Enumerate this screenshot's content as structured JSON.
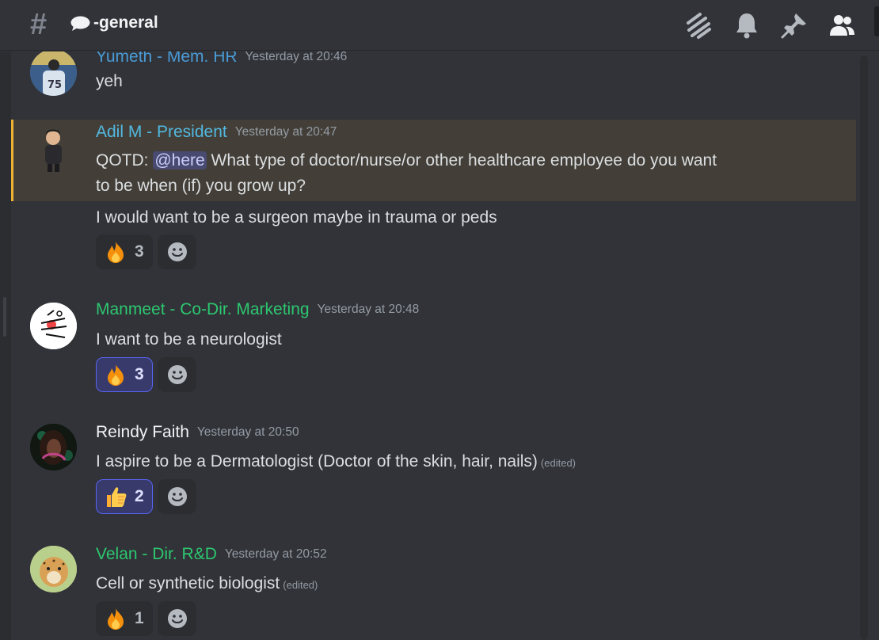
{
  "channel": {
    "name": "-general"
  },
  "colors": {
    "background": "#313338",
    "highlight": "#433f38",
    "highlight_bar": "#f0b232",
    "blue_role": "#4a9bd6",
    "teal_role": "#52b8e0",
    "green_role": "#2dc770",
    "white_role": "#f2f3f5"
  },
  "header_icons": [
    "threads-icon",
    "bell-icon",
    "pin-icon",
    "members-icon"
  ],
  "messages": [
    {
      "author": "Yumeth - Mem. HR",
      "timestamp": "Yesterday at 20:46",
      "text": "yeh"
    },
    {
      "author": "Adil M - President",
      "timestamp": "Yesterday at 20:47",
      "qotd_prefix": "QOTD: ",
      "mention": "@here",
      "line1": " What type of doctor/nurse/or other healthcare employee do you want",
      "line2": "to be when (if) you grow up?",
      "followup": "I would want to be a surgeon maybe in trauma or peds",
      "reaction": {
        "emoji": "fire-emoji",
        "count": "3"
      }
    },
    {
      "author": "Manmeet - Co-Dir. Marketing",
      "timestamp": "Yesterday at 20:48",
      "text": "I want to be a neurologist",
      "reaction": {
        "emoji": "fire-emoji",
        "count": "3"
      }
    },
    {
      "author": "Reindy Faith",
      "timestamp": "Yesterday at 20:50",
      "text": "I aspire to be a Dermatologist (Doctor of the skin, hair, nails)",
      "edited": "(edited)",
      "reaction": {
        "emoji": "thumbs-up-emoji",
        "count": "2"
      }
    },
    {
      "author": "Velan - Dir. R&D",
      "timestamp": "Yesterday at 20:52",
      "text": "Cell or synthetic biologist",
      "edited": "(edited)",
      "reaction": {
        "emoji": "fire-emoji",
        "count": "1"
      }
    }
  ]
}
